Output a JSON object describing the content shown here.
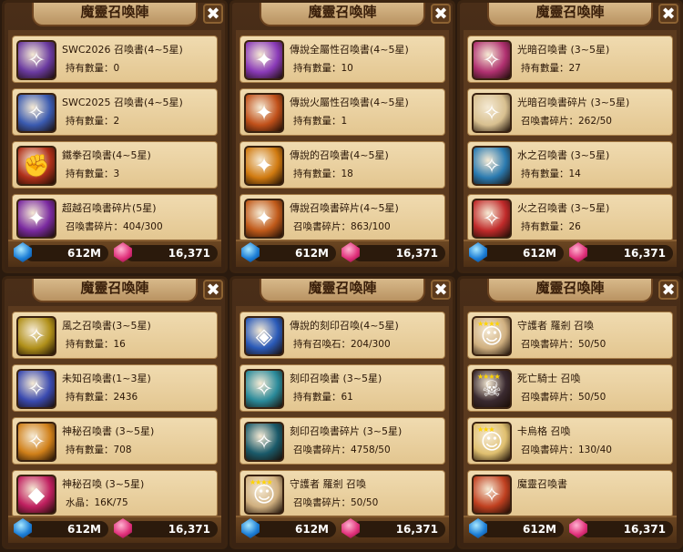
{
  "panels": [
    {
      "title": "魔靈召喚陣",
      "close": "✖",
      "mana": "612M",
      "crystal": "16,371",
      "items": [
        {
          "name": "SWC2026 召喚書(4~5星)",
          "sub": "持有數量：0",
          "icon": "swc2026-scroll-icon",
          "color": "#6a3aa0",
          "glyph": "✧"
        },
        {
          "name": "SWC2025 召喚書(4~5星)",
          "sub": "持有數量：2",
          "icon": "swc2025-scroll-icon",
          "color": "#3a5ab0",
          "glyph": "✧"
        },
        {
          "name": "鐵拳召喚書(4~5星)",
          "sub": "持有數量：3",
          "icon": "iron-fist-scroll-icon",
          "color": "#b0301a",
          "glyph": "✊"
        },
        {
          "name": "超越召喚書碎片(5星)",
          "sub": "召喚書碎片：404/300",
          "icon": "transcendence-scroll-icon",
          "color": "#7a2aa0",
          "glyph": "✦"
        }
      ]
    },
    {
      "title": "魔靈召喚陣",
      "close": "✖",
      "mana": "612M",
      "crystal": "16,371",
      "items": [
        {
          "name": "傳說全屬性召喚書(4~5星)",
          "sub": "持有數量：10",
          "icon": "legendary-all-attribute-scroll-icon",
          "color": "#8a3ab8",
          "glyph": "✦"
        },
        {
          "name": "傳說火屬性召喚書(4~5星)",
          "sub": "持有數量：1",
          "icon": "legendary-fire-scroll-icon",
          "color": "#c0501a",
          "glyph": "✦"
        },
        {
          "name": "傳說的召喚書(4~5星)",
          "sub": "持有數量：18",
          "icon": "legendary-scroll-icon",
          "color": "#d07a10",
          "glyph": "✦"
        },
        {
          "name": "傳說召喚書碎片(4~5星)",
          "sub": "召喚書碎片：863/100",
          "icon": "legendary-scroll-piece-icon",
          "color": "#c05a1a",
          "glyph": "✦"
        }
      ]
    },
    {
      "title": "魔靈召喚陣",
      "close": "✖",
      "mana": "612M",
      "crystal": "16,371",
      "items": [
        {
          "name": "光暗召喚書 (3~5星)",
          "sub": "持有數量：27",
          "icon": "light-dark-scroll-icon",
          "color": "#b03070",
          "glyph": "✧"
        },
        {
          "name": "光暗召喚書碎片 (3~5星)",
          "sub": "召喚書碎片：262/50",
          "icon": "light-dark-scroll-piece-icon",
          "color": "#d8c090",
          "glyph": "✧"
        },
        {
          "name": "水之召喚書 (3~5星)",
          "sub": "持有數量：14",
          "icon": "water-scroll-icon",
          "color": "#2a7ab0",
          "glyph": "✧"
        },
        {
          "name": "火之召喚書 (3~5星)",
          "sub": "持有數量：26",
          "icon": "fire-scroll-icon",
          "color": "#c02a2a",
          "glyph": "✧"
        }
      ]
    },
    {
      "title": "魔靈召喚陣",
      "close": "✖",
      "mana": "612M",
      "crystal": "16,371",
      "items": [
        {
          "name": "風之召喚書(3~5星)",
          "sub": "持有數量：16",
          "icon": "wind-scroll-icon",
          "color": "#b0901a",
          "glyph": "✧"
        },
        {
          "name": "未知召喚書(1~3星)",
          "sub": "持有數量：2436",
          "icon": "unknown-scroll-icon",
          "color": "#3a4ab0",
          "glyph": "✧"
        },
        {
          "name": "神秘召喚書 (3~5星)",
          "sub": "持有數量：708",
          "icon": "mystical-scroll-icon",
          "color": "#d0801a",
          "glyph": "✧"
        },
        {
          "name": "神秘召喚 (3~5星)",
          "sub": "水晶：16K/75",
          "icon": "mystical-crystal-icon",
          "color": "#c02060",
          "glyph": "◆"
        }
      ]
    },
    {
      "title": "魔靈召喚陣",
      "close": "✖",
      "mana": "612M",
      "crystal": "16,371",
      "items": [
        {
          "name": "傳說的刻印召喚(4~5星)",
          "sub": "持有召喚石：204/300",
          "icon": "legendary-engraved-stone-icon",
          "color": "#2a5ab8",
          "glyph": "◈"
        },
        {
          "name": "刻印召喚書 (3~5星)",
          "sub": "持有數量：61",
          "icon": "engraved-scroll-icon",
          "color": "#2a8a9a",
          "glyph": "✧"
        },
        {
          "name": "刻印召喚書碎片 (3~5星)",
          "sub": "召喚書碎片：4758/50",
          "icon": "engraved-scroll-piece-icon",
          "color": "#1a5a6a",
          "glyph": "✧"
        },
        {
          "name": "守護者 羅剎 召喚",
          "sub": "召喚書碎片：50/50",
          "icon": "guardian-rakshasa-portrait-icon",
          "color": "#d0b080",
          "glyph": "☺",
          "stars": "★★★★"
        }
      ]
    },
    {
      "title": "魔靈召喚陣",
      "close": "✖",
      "mana": "612M",
      "crystal": "16,371",
      "items": [
        {
          "name": "守護者 羅剎 召喚",
          "sub": "召喚書碎片：50/50",
          "icon": "guardian-rakshasa-portrait-icon",
          "color": "#d0b080",
          "glyph": "☺",
          "stars": "★★★★"
        },
        {
          "name": "死亡騎士 召喚",
          "sub": "召喚書碎片：50/50",
          "icon": "death-knight-portrait-icon",
          "color": "#3a2a30",
          "glyph": "☠",
          "stars": "★★★★"
        },
        {
          "name": "卡烏格 召喚",
          "sub": "召喚書碎片：130/40",
          "icon": "kaoug-portrait-icon",
          "color": "#e0c070",
          "glyph": "☺",
          "stars": "★★★"
        },
        {
          "name": "魔靈召喚書",
          "sub": "",
          "icon": "monster-summon-scroll-icon",
          "color": "#c04020",
          "glyph": "✧"
        }
      ]
    }
  ]
}
